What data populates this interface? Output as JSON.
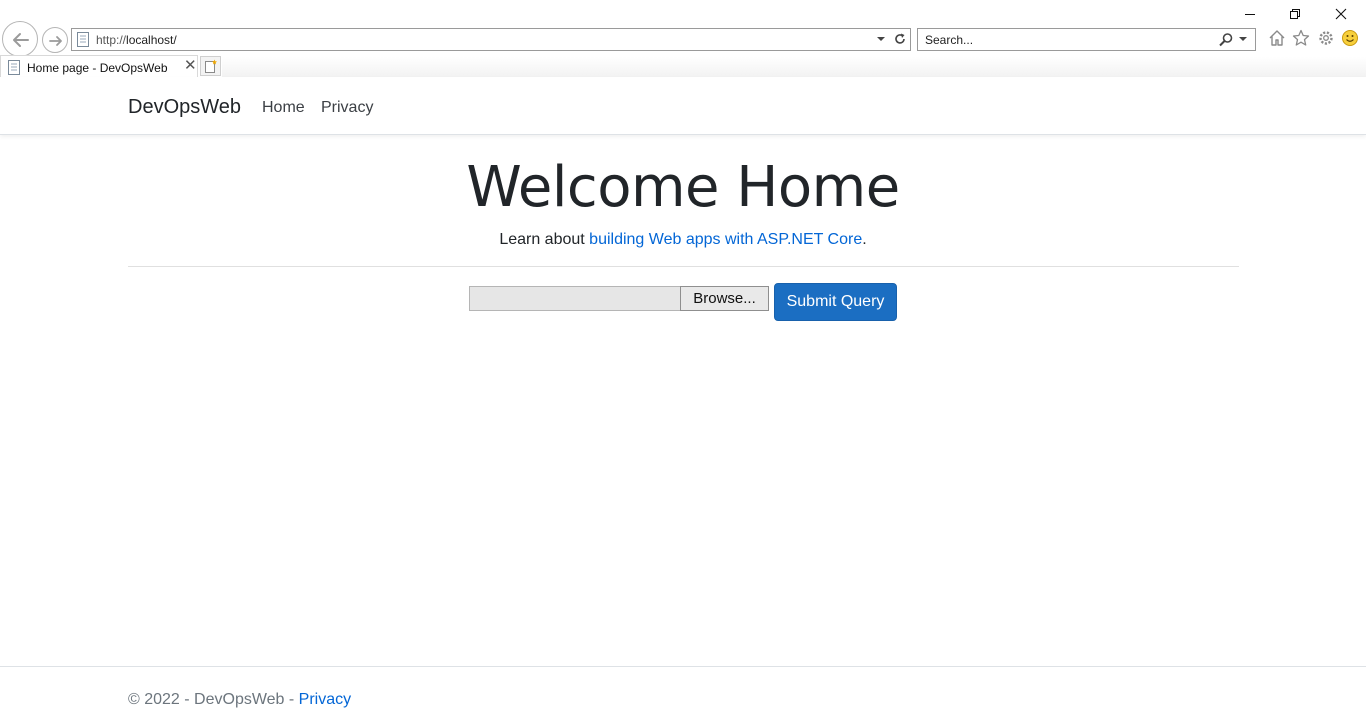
{
  "browser": {
    "url_scheme": "http://",
    "url_host": "localhost/",
    "search_placeholder": "Search...",
    "tab_title": "Home page - DevOpsWeb",
    "tab_close": "✕",
    "icons": [
      "back-icon",
      "forward-icon",
      "page-icon",
      "dropdown-icon",
      "refresh-icon",
      "search-icon",
      "home-icon",
      "favorites-star-icon",
      "settings-gear-icon",
      "feedback-smiley-icon",
      "minimize-icon",
      "restore-icon",
      "close-icon",
      "new-tab-icon"
    ]
  },
  "navbar": {
    "brand": "DevOpsWeb",
    "links": [
      "Home",
      "Privacy"
    ]
  },
  "main": {
    "title": "Welcome Home",
    "sub_prefix": "Learn about ",
    "sub_link": "building Web apps with ASP.NET Core",
    "sub_suffix": ".",
    "browse_label": "Browse...",
    "submit_label": "Submit Query"
  },
  "footer": {
    "text": "© 2022 - DevOpsWeb - ",
    "link": "Privacy"
  },
  "colors": {
    "primary_button": "#1b6ec2",
    "link": "#0366d6",
    "footer_text": "#6c757d"
  }
}
